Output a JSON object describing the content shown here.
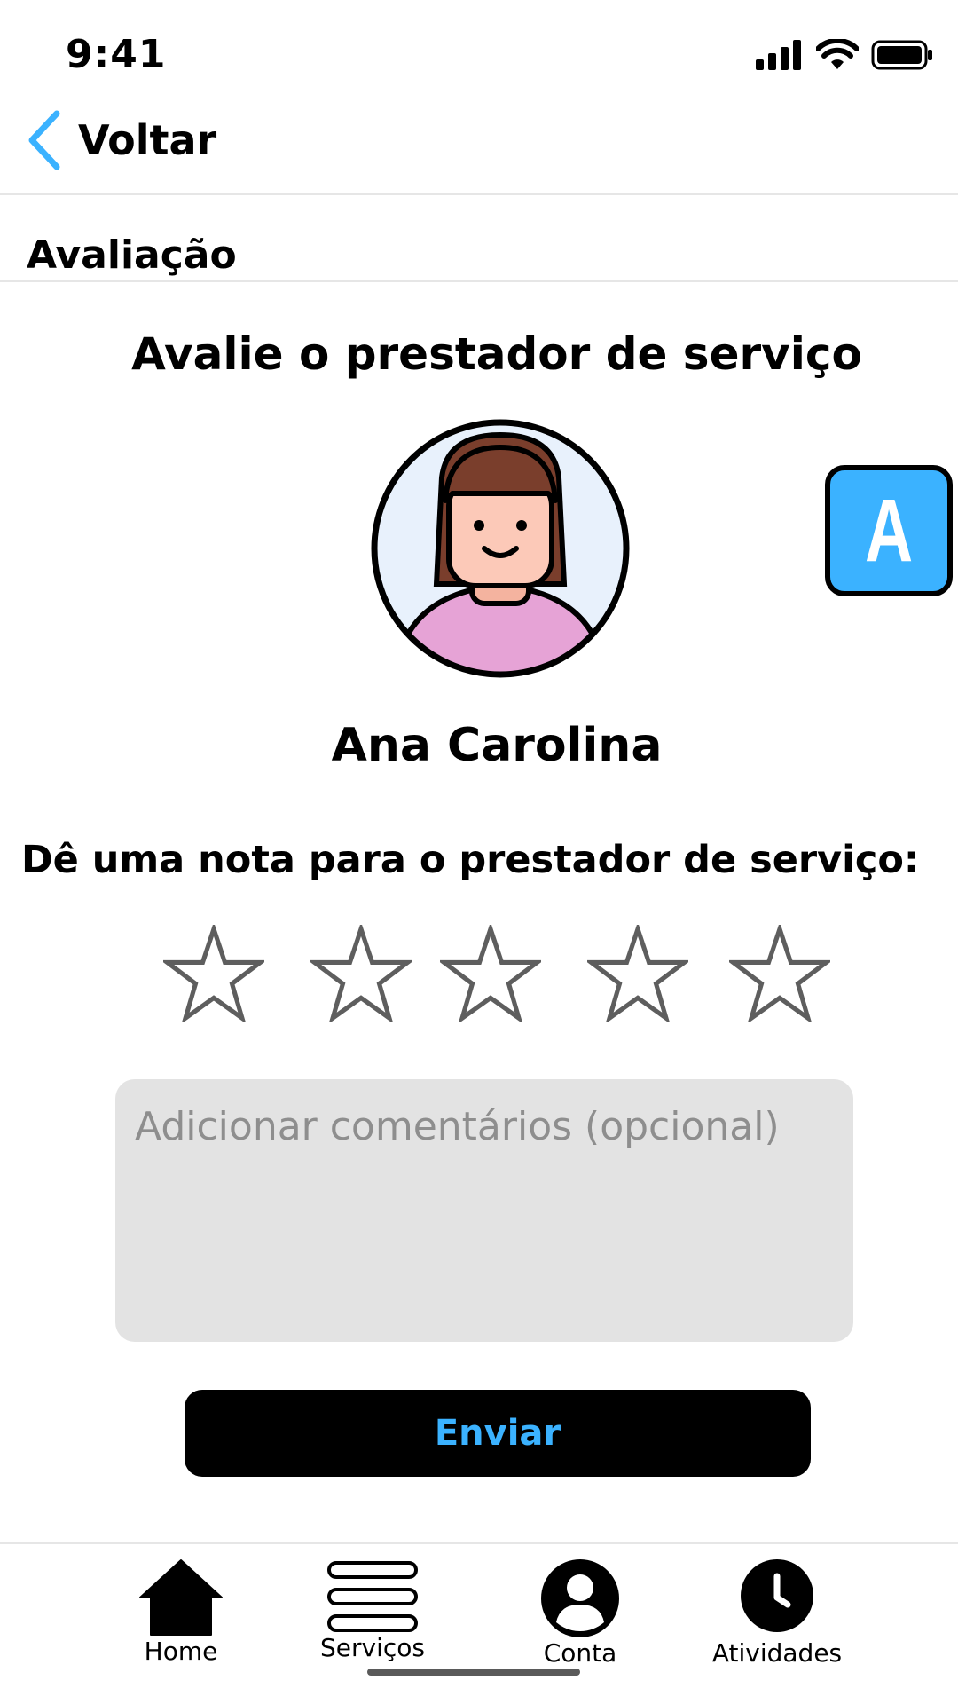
{
  "status_bar": {
    "time": "9:41"
  },
  "header": {
    "back_label": "Voltar"
  },
  "section": {
    "title": "Avaliação"
  },
  "rating": {
    "prompt_title": "Avalie o prestador de serviço",
    "provider_name": "Ana Carolina",
    "badge_letter": "A",
    "instruction": "Dê uma nota para o prestador de serviço:",
    "stars_total": 5,
    "stars_selected": 0,
    "comment_placeholder": "Adicionar comentários (opcional)",
    "submit_label": "Enviar"
  },
  "tab_bar": {
    "items": [
      {
        "label": "Home",
        "icon": "home-icon"
      },
      {
        "label": "Serviços",
        "icon": "menu-icon"
      },
      {
        "label": "Conta",
        "icon": "account-icon"
      },
      {
        "label": "Atividades",
        "icon": "clock-icon"
      }
    ]
  },
  "colors": {
    "accent": "#3bb2ff",
    "button_bg": "#000000",
    "input_bg": "#e3e3e3"
  }
}
